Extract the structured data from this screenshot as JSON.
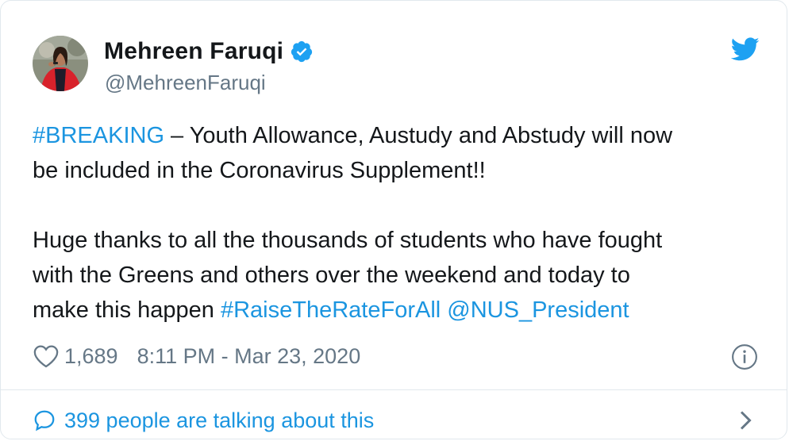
{
  "author": {
    "name": "Mehreen Faruqi",
    "handle": "@MehreenFaruqi",
    "verified": true
  },
  "tweet": {
    "line1_hashtag": "#BREAKING",
    "line1_text": " – Youth Allowance, Austudy and Abstudy will now\nbe included in the Coronavirus Supplement!!\n\nHuge thanks to all the thousands of students who have fought\nwith the Greens and others over the weekend and today to\nmake this happen ",
    "hashtag_2": "#RaiseTheRateForAll",
    "space": " ",
    "mention": "@NUS_President"
  },
  "meta": {
    "like_count": "1,689",
    "timestamp": "8:11 PM - Mar 23, 2020"
  },
  "footer": {
    "talking_text": "399 people are talking about this"
  },
  "icons": {
    "brand": "twitter-bird-icon",
    "verified": "verified-badge-icon",
    "like": "heart-icon",
    "info": "info-icon",
    "comment": "speech-bubble-icon",
    "more": "chevron-right-icon"
  },
  "colors": {
    "link": "#1b95e0",
    "muted": "#657786",
    "text": "#14171a",
    "border": "#e1e8ed",
    "twitter_blue": "#1da1f2"
  }
}
